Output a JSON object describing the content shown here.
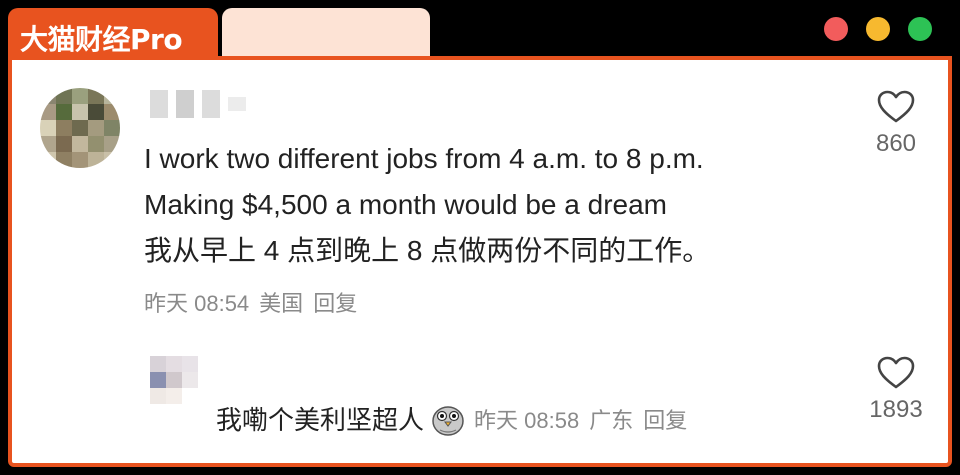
{
  "brand": {
    "logo_text": "大猫财经Pro"
  },
  "window_controls": [
    "close",
    "minimize",
    "maximize"
  ],
  "colors": {
    "brand": "#e8531f",
    "tab_light": "#fde3d5"
  },
  "comment": {
    "lines": [
      "I work two different jobs from 4 a.m. to 8 p.m.",
      "Making $4,500 a month would be a dream",
      "我从早上 4 点到晚上 8 点做两份不同的工作。"
    ],
    "time": "昨天 08:54",
    "location": "美国",
    "reply_label": "回复",
    "like_count": "860",
    "like_icon": "heart-outline-icon"
  },
  "reply": {
    "text": "我嘞个美利坚超人",
    "emoji": "pigeon-emoji",
    "time": "昨天 08:58",
    "location": "广东",
    "reply_label": "回复",
    "like_count": "1893",
    "like_icon": "heart-outline-icon"
  }
}
